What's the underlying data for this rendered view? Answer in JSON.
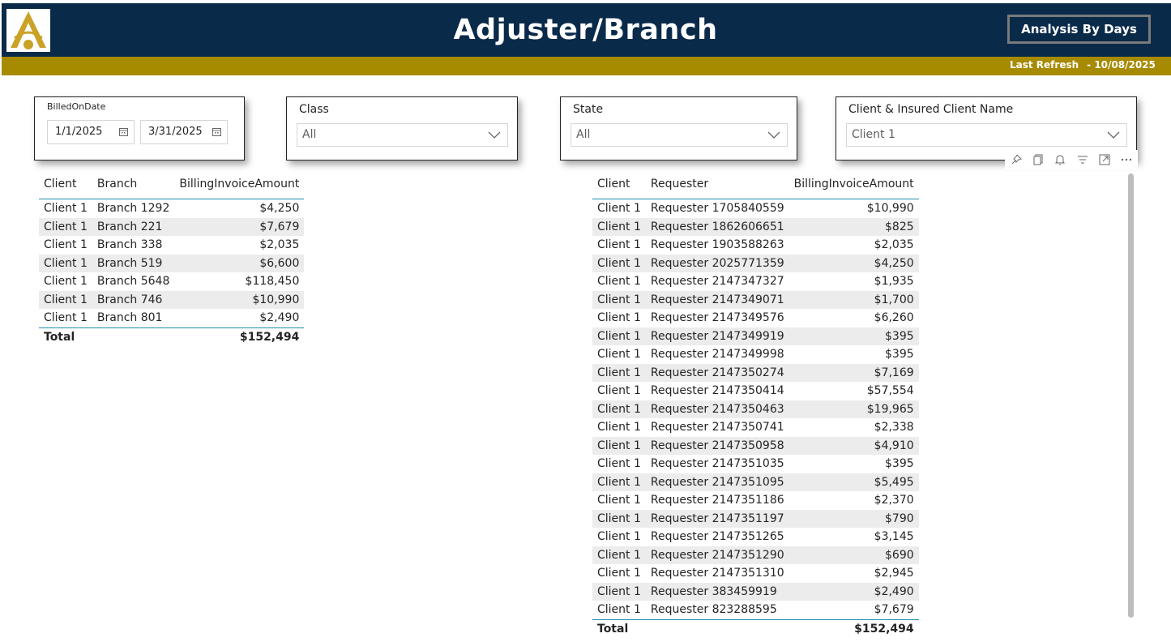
{
  "header": {
    "title": "Adjuster/Branch",
    "analysis_button": "Analysis By Days",
    "refresh_label": "Last Refresh",
    "refresh_date": "- 10/08/2025",
    "colors": {
      "navy": "#0a2a4a",
      "gold": "#a68a00"
    }
  },
  "filters": {
    "billed_on_date": {
      "label": "BilledOnDate",
      "start": "1/1/2025",
      "end": "3/31/2025"
    },
    "class": {
      "label": "Class",
      "value": "All"
    },
    "state": {
      "label": "State",
      "value": "All"
    },
    "client": {
      "label": "Client & Insured Client Name",
      "value": "Client 1"
    }
  },
  "branch_table": {
    "columns": [
      "Client",
      "Branch",
      "BillingInvoiceAmount"
    ],
    "rows": [
      [
        "Client 1",
        "Branch 1292",
        "$4,250"
      ],
      [
        "Client 1",
        "Branch 221",
        "$7,679"
      ],
      [
        "Client 1",
        "Branch 338",
        "$2,035"
      ],
      [
        "Client 1",
        "Branch 519",
        "$6,600"
      ],
      [
        "Client 1",
        "Branch 5648",
        "$118,450"
      ],
      [
        "Client 1",
        "Branch 746",
        "$10,990"
      ],
      [
        "Client 1",
        "Branch 801",
        "$2,490"
      ]
    ],
    "total_label": "Total",
    "total_value": "$152,494"
  },
  "requester_table": {
    "columns": [
      "Client",
      "Requester",
      "BillingInvoiceAmount"
    ],
    "rows": [
      [
        "Client 1",
        "Requester 1705840559",
        "$10,990"
      ],
      [
        "Client 1",
        "Requester 1862606651",
        "$825"
      ],
      [
        "Client 1",
        "Requester 1903588263",
        "$2,035"
      ],
      [
        "Client 1",
        "Requester 2025771359",
        "$4,250"
      ],
      [
        "Client 1",
        "Requester 2147347327",
        "$1,935"
      ],
      [
        "Client 1",
        "Requester 2147349071",
        "$1,700"
      ],
      [
        "Client 1",
        "Requester 2147349576",
        "$6,260"
      ],
      [
        "Client 1",
        "Requester 2147349919",
        "$395"
      ],
      [
        "Client 1",
        "Requester 2147349998",
        "$395"
      ],
      [
        "Client 1",
        "Requester 2147350274",
        "$7,169"
      ],
      [
        "Client 1",
        "Requester 2147350414",
        "$57,554"
      ],
      [
        "Client 1",
        "Requester 2147350463",
        "$19,965"
      ],
      [
        "Client 1",
        "Requester 2147350741",
        "$2,338"
      ],
      [
        "Client 1",
        "Requester 2147350958",
        "$4,910"
      ],
      [
        "Client 1",
        "Requester 2147351035",
        "$395"
      ],
      [
        "Client 1",
        "Requester 2147351095",
        "$5,495"
      ],
      [
        "Client 1",
        "Requester 2147351186",
        "$2,370"
      ],
      [
        "Client 1",
        "Requester 2147351197",
        "$790"
      ],
      [
        "Client 1",
        "Requester 2147351265",
        "$3,145"
      ],
      [
        "Client 1",
        "Requester 2147351290",
        "$690"
      ],
      [
        "Client 1",
        "Requester 2147351310",
        "$2,945"
      ],
      [
        "Client 1",
        "Requester 383459919",
        "$2,490"
      ],
      [
        "Client 1",
        "Requester 823288595",
        "$7,679"
      ]
    ],
    "total_label": "Total",
    "total_value": "$152,494"
  },
  "visual_toolbar": {
    "icons": [
      "pin-icon",
      "copy-icon",
      "bell-icon",
      "filter-icon",
      "focus-mode-icon",
      "more-options-icon"
    ]
  }
}
